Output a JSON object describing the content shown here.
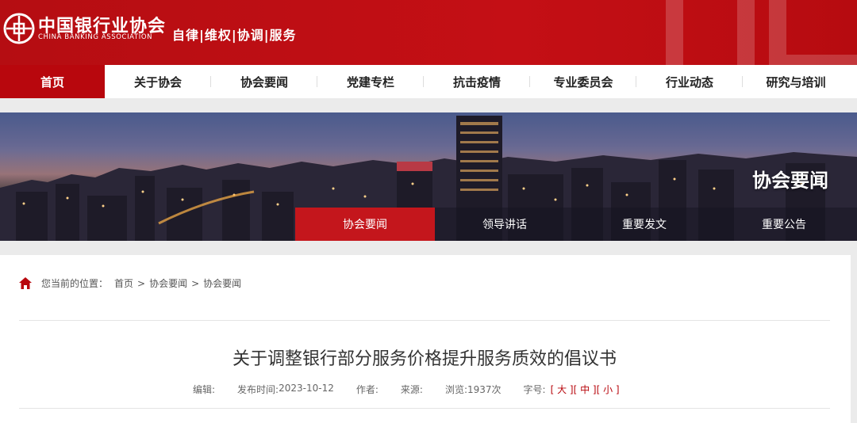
{
  "header": {
    "org_name_cn": "中国银行业协会",
    "org_name_en": "CHINA BANKING ASSOCIATION",
    "slogan": "自律|维权|协调|服务"
  },
  "nav": {
    "items": [
      {
        "label": "首页",
        "active": true
      },
      {
        "label": "关于协会"
      },
      {
        "label": "协会要闻"
      },
      {
        "label": "党建专栏"
      },
      {
        "label": "抗击疫情"
      },
      {
        "label": "专业委员会"
      },
      {
        "label": "行业动态"
      },
      {
        "label": "研究与培训"
      }
    ]
  },
  "banner": {
    "title": "协会要闻",
    "subnav": [
      {
        "label": "协会要闻",
        "active": true
      },
      {
        "label": "领导讲话"
      },
      {
        "label": "重要发文"
      },
      {
        "label": "重要公告"
      }
    ]
  },
  "breadcrumb": {
    "prefix": "您当前的位置：",
    "items": [
      "首页",
      "协会要闻",
      "协会要闻"
    ],
    "separator": ">"
  },
  "article": {
    "title": "关于调整银行部分服务价格提升服务质效的倡议书",
    "meta": {
      "editor_label": "编辑:",
      "publish_label": "发布时间:",
      "publish_date": "2023-10-12",
      "author_label": "作者:",
      "source_label": "来源:",
      "views_label": "浏览:",
      "views_value": "1937次",
      "font_label": "字号:",
      "font_large": "[ 大 ]",
      "font_medium": "[ 中 ]",
      "font_small": "[ 小 ]"
    }
  },
  "colors": {
    "brand_red": "#b8070d",
    "header_red": "#c40f15"
  },
  "icons": {
    "logo": "coin-logo-icon",
    "home": "home-icon"
  }
}
